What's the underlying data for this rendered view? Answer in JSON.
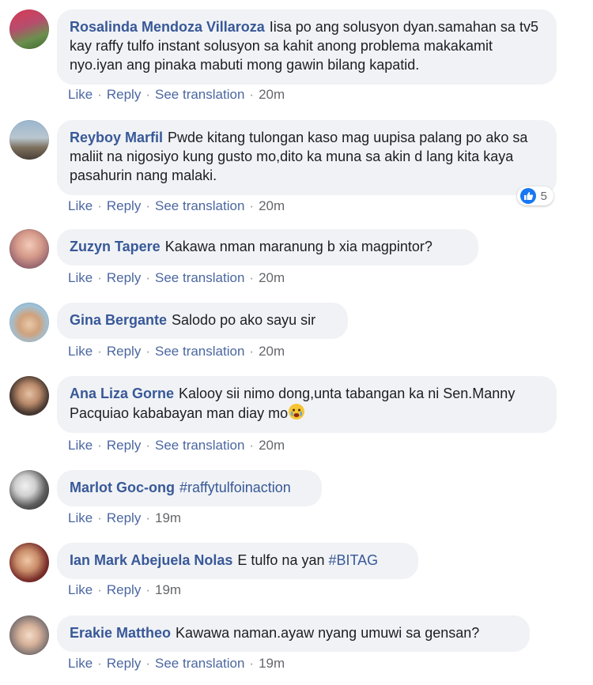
{
  "actions": {
    "like": "Like",
    "reply": "Reply",
    "see_translation": "See translation",
    "dot": "·"
  },
  "comments": [
    {
      "author": "Rosalinda Mendoza Villaroza",
      "text": "Iisa po ang solusyon dyan.samahan sa tv5 kay raffy tulfo instant solusyon sa kahit anong problema makakamit nyo.iyan ang pinaka mabuti mong gawin bilang kapatid.",
      "time": "20m"
    },
    {
      "author": "Reyboy Marfil",
      "text": "Pwde kitang tulongan kaso mag uupisa palang po ako sa maliit na nigosiyo kung gusto mo,dito ka muna sa akin d lang kita kaya pasahurin nang malaki.",
      "time": "20m",
      "reaction_count": "5"
    },
    {
      "author": "Zuzyn Tapere",
      "text": "Kakawa nman maranung b xia magpintor?",
      "time": "20m"
    },
    {
      "author": "Gina Bergante",
      "text": "Salodo po ako sayu sir",
      "time": "20m"
    },
    {
      "author": "Ana Liza Gorne",
      "text": "Kalooy sii nimo dong,unta tabangan ka ni Sen.Manny Pacquiao kababayan man diay mo",
      "time": "20m"
    },
    {
      "author": "Marlot Goc-ong",
      "text": "#raffytulfoinaction",
      "time": "19m"
    },
    {
      "author": "Ian Mark Abejuela Nolas",
      "text": "E tulfo na yan",
      "hashtag": "#BITAG",
      "time": "19m"
    },
    {
      "author": "Erakie Mattheo",
      "text": "Kawawa naman.ayaw nyang umuwi sa gensan?",
      "time": "19m"
    }
  ],
  "colors": {
    "name": "#385898",
    "bubble": "#f0f2f5",
    "meta": "#65676b",
    "like_blue": "#1877f2"
  }
}
